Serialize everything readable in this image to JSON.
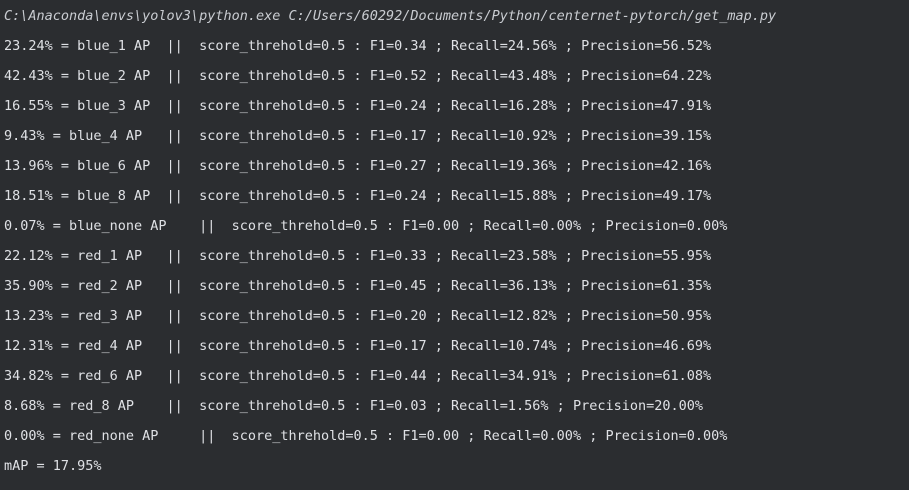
{
  "console": {
    "command": "C:\\Anaconda\\envs\\yolov3\\python.exe C:/Users/60292/Documents/Python/centernet-pytorch/get_map.py",
    "lines": [
      "23.24% = blue_1 AP  ||  score_threhold=0.5 : F1=0.34 ; Recall=24.56% ; Precision=56.52%",
      "42.43% = blue_2 AP  ||  score_threhold=0.5 : F1=0.52 ; Recall=43.48% ; Precision=64.22%",
      "16.55% = blue_3 AP  ||  score_threhold=0.5 : F1=0.24 ; Recall=16.28% ; Precision=47.91%",
      "9.43% = blue_4 AP   ||  score_threhold=0.5 : F1=0.17 ; Recall=10.92% ; Precision=39.15%",
      "13.96% = blue_6 AP  ||  score_threhold=0.5 : F1=0.27 ; Recall=19.36% ; Precision=42.16%",
      "18.51% = blue_8 AP  ||  score_threhold=0.5 : F1=0.24 ; Recall=15.88% ; Precision=49.17%",
      "0.07% = blue_none AP    ||  score_threhold=0.5 : F1=0.00 ; Recall=0.00% ; Precision=0.00%",
      "22.12% = red_1 AP   ||  score_threhold=0.5 : F1=0.33 ; Recall=23.58% ; Precision=55.95%",
      "35.90% = red_2 AP   ||  score_threhold=0.5 : F1=0.45 ; Recall=36.13% ; Precision=61.35%",
      "13.23% = red_3 AP   ||  score_threhold=0.5 : F1=0.20 ; Recall=12.82% ; Precision=50.95%",
      "12.31% = red_4 AP   ||  score_threhold=0.5 : F1=0.17 ; Recall=10.74% ; Precision=46.69%",
      "34.82% = red_6 AP   ||  score_threhold=0.5 : F1=0.44 ; Recall=34.91% ; Precision=61.08%",
      "8.68% = red_8 AP    ||  score_threhold=0.5 : F1=0.03 ; Recall=1.56% ; Precision=20.00%",
      "0.00% = red_none AP     ||  score_threhold=0.5 : F1=0.00 ; Recall=0.00% ; Precision=0.00%",
      "mAP = 17.95%"
    ]
  }
}
